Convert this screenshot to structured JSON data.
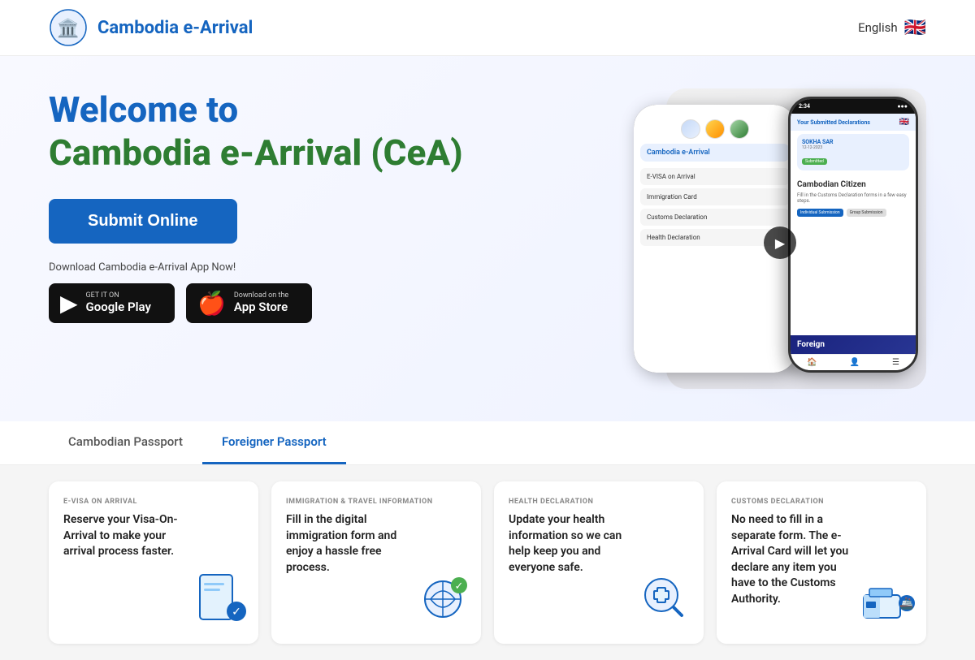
{
  "header": {
    "title": "Cambodia e-Arrival",
    "lang_label": "English",
    "logo_emoji": "🏛️"
  },
  "hero": {
    "welcome_line1": "Welcome to",
    "welcome_line2": "Cambodia e-Arrival (CeA)",
    "submit_label": "Submit Online",
    "download_label": "Download Cambodia e-Arrival App Now!",
    "google_play_top": "GET IT ON",
    "google_play_main": "Google Play",
    "app_store_top": "Download on the",
    "app_store_main": "App Store"
  },
  "phone": {
    "time": "2:34",
    "app_name": "Cambodia e-Arrival",
    "menu_items": [
      "E-VISA on Arrival",
      "Immigration Card",
      "Customs Declaration",
      "Health Declaration"
    ],
    "card_name": "SOKHA SAR",
    "card_date": "12-12-2023",
    "card_status": "Submitted",
    "citizen_title": "Cambodian Citizen",
    "citizen_desc": "Fill in the Customs Declaration forms in a few easy steps.",
    "btn_individual": "Individual Submission",
    "btn_group": "Group Submission",
    "foreign_label": "Foreign"
  },
  "tabs": [
    {
      "label": "Cambodian Passport",
      "active": false
    },
    {
      "label": "Foreigner Passport",
      "active": true
    }
  ],
  "cards": [
    {
      "tag": "E-VISA ON ARRIVAL",
      "title": "Reserve your Visa-On-Arrival to make your arrival process faster.",
      "icon": "📄"
    },
    {
      "tag": "IMMIGRATION & TRAVEL INFORMATION",
      "title": "Fill in the digital immigration form and enjoy a hassle free process.",
      "icon": "🌐"
    },
    {
      "tag": "HEALTH DECLARATION",
      "title": "Update your health information so we can help keep you and everyone safe.",
      "icon": "🏥"
    },
    {
      "tag": "CUSTOMS DECLARATION",
      "title": "No need to fill in a separate form. The e-Arrival Card will let you declare any item you have to the Customs Authority.",
      "icon": "🚢"
    }
  ]
}
